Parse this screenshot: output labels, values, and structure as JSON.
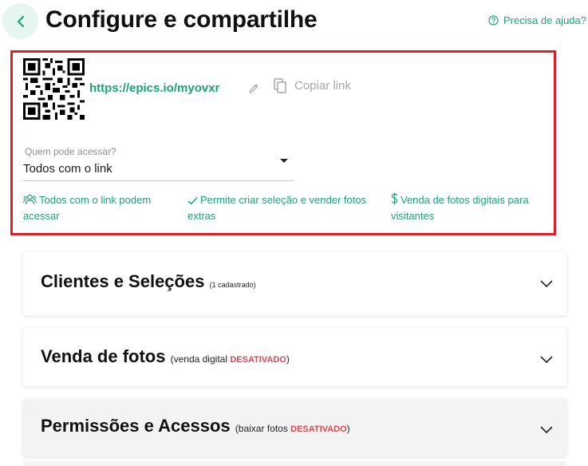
{
  "header": {
    "title": "Configure e compartilhe",
    "help_label": "Precisa de ajuda?"
  },
  "share": {
    "url": "https://epics.io/myovxr",
    "copy_label": "Copiar link",
    "access_label": "Quem pode acessar?",
    "access_value": "Todos com o link",
    "features": [
      "Todos com o link podem acessar",
      "Permite criar seleção e vender fotos extras",
      "Venda de fotos digitais para visitantes"
    ]
  },
  "cards": {
    "clients": {
      "title": "Clientes e Seleções",
      "sub": "(1 cadastrado)"
    },
    "sales": {
      "title": "Venda de fotos",
      "sub_prefix": "(venda digital ",
      "status": "DESATIVADO",
      "sub_suffix": ")"
    },
    "perms": {
      "title": "Permissões e Acessos",
      "sub_prefix": "(baixar fotos ",
      "status": "DESATIVADO",
      "sub_suffix": ")"
    }
  },
  "colors": {
    "accent": "#1aa37a",
    "highlight_border": "#e01e26",
    "disabled": "#e4444c",
    "back_bg": "#e6f6f1"
  },
  "icons": [
    "arrow-left-icon",
    "help-circle-icon",
    "qr-code",
    "pencil-icon",
    "copy-icon",
    "caret-down-icon",
    "users-icon",
    "check-icon",
    "dollar-icon",
    "chevron-down-icon"
  ]
}
